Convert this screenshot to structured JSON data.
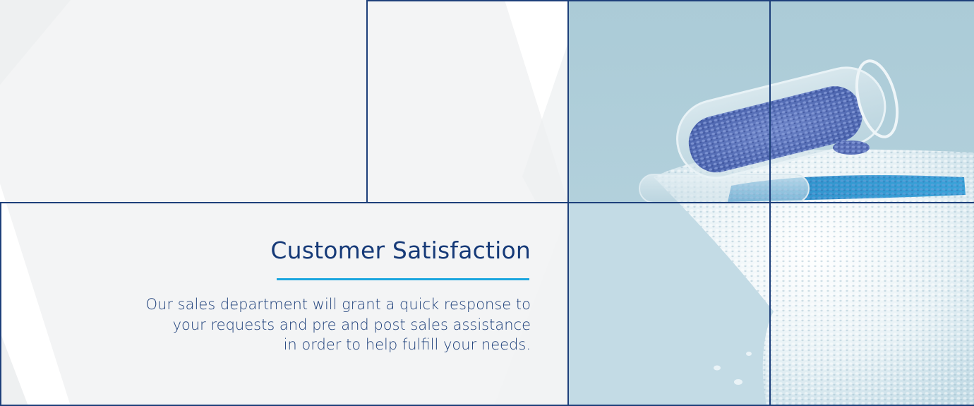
{
  "section": {
    "title": "Customer Satisfaction",
    "body_lines": [
      "Our sales department will grant a quick response to",
      "your requests and pre and post sales assistance",
      "in order to help fulfill your needs."
    ]
  },
  "colors": {
    "title": "#163a78",
    "accent_underline": "#1aa6df",
    "frame": "#1d3f7a",
    "panel_bg": "#f3f4f5",
    "photo_bg": "#a9cbd6"
  },
  "photo": {
    "subject": "glass test tube spilling blue and clear plastic pellets",
    "icon": "photo-image"
  }
}
